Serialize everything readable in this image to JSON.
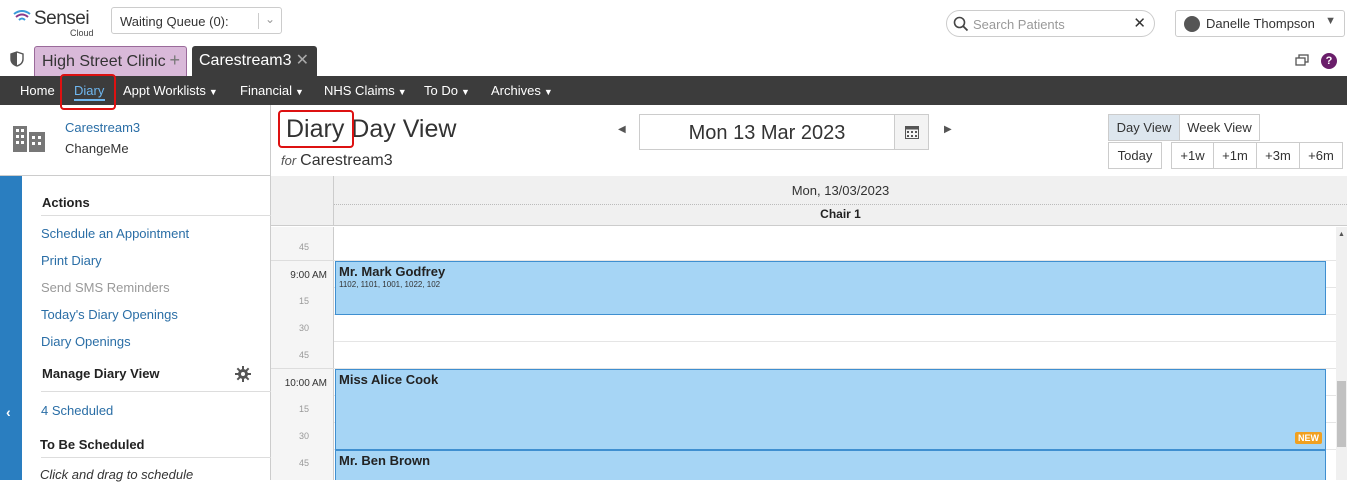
{
  "logo": {
    "brand": "Sensei",
    "sub": "Cloud"
  },
  "waiting_queue": {
    "label": "Waiting Queue (0):"
  },
  "search": {
    "placeholder": "Search Patients"
  },
  "user": {
    "name": "Danelle Thompson"
  },
  "tabs": [
    {
      "label": "High Street Clinic"
    },
    {
      "label": "Carestream3"
    }
  ],
  "nav": {
    "items": [
      {
        "label": "Home"
      },
      {
        "label": "Diary"
      },
      {
        "label": "Appt Worklists"
      },
      {
        "label": "Financial"
      },
      {
        "label": "NHS Claims"
      },
      {
        "label": "To Do"
      },
      {
        "label": "Archives"
      }
    ],
    "active": "Diary"
  },
  "practice": {
    "name": "Carestream3",
    "sub": "ChangeMe"
  },
  "page": {
    "title_a": "Diary",
    "title_b": "Day View",
    "for_label": "for",
    "for_value": "Carestream3"
  },
  "date": {
    "current": "Mon 13 Mar 2023"
  },
  "view_buttons": {
    "day": "Day View",
    "week": "Week View",
    "today": "Today",
    "w1": "+1w",
    "m1": "+1m",
    "m3": "+3m",
    "m6": "+6m"
  },
  "sidebar": {
    "actions_title": "Actions",
    "actions": [
      {
        "label": "Schedule an Appointment",
        "enabled": true
      },
      {
        "label": "Print Diary",
        "enabled": true
      },
      {
        "label": "Send SMS Reminders",
        "enabled": false
      },
      {
        "label": "Today's Diary Openings",
        "enabled": true
      },
      {
        "label": "Diary Openings",
        "enabled": true
      }
    ],
    "manage_title": "Manage Diary View",
    "scheduled": "4 Scheduled",
    "to_be_title": "To Be Scheduled",
    "hint": "Click and drag to schedule"
  },
  "calendar": {
    "date_header": "Mon, 13/03/2023",
    "chair": "Chair 1",
    "times": [
      "45",
      "9:00 AM",
      "15",
      "30",
      "45",
      "10:00 AM",
      "15",
      "30",
      "45"
    ],
    "appointments": [
      {
        "name": "Mr. Mark Godfrey",
        "codes": "1102, 1101, 1001, 1022, 102",
        "badge": ""
      },
      {
        "name": "Miss Alice Cook",
        "codes": "",
        "badge": "NEW"
      },
      {
        "name": "Mr. Ben Brown",
        "codes": "",
        "badge": ""
      }
    ]
  },
  "colors": {
    "nav_bg": "#3c3c3c",
    "accent": "#2a6ea6",
    "appt_fill": "#a6d5f5",
    "tab_clinic": "#d9b9d9",
    "highlight": "#dd1111"
  }
}
